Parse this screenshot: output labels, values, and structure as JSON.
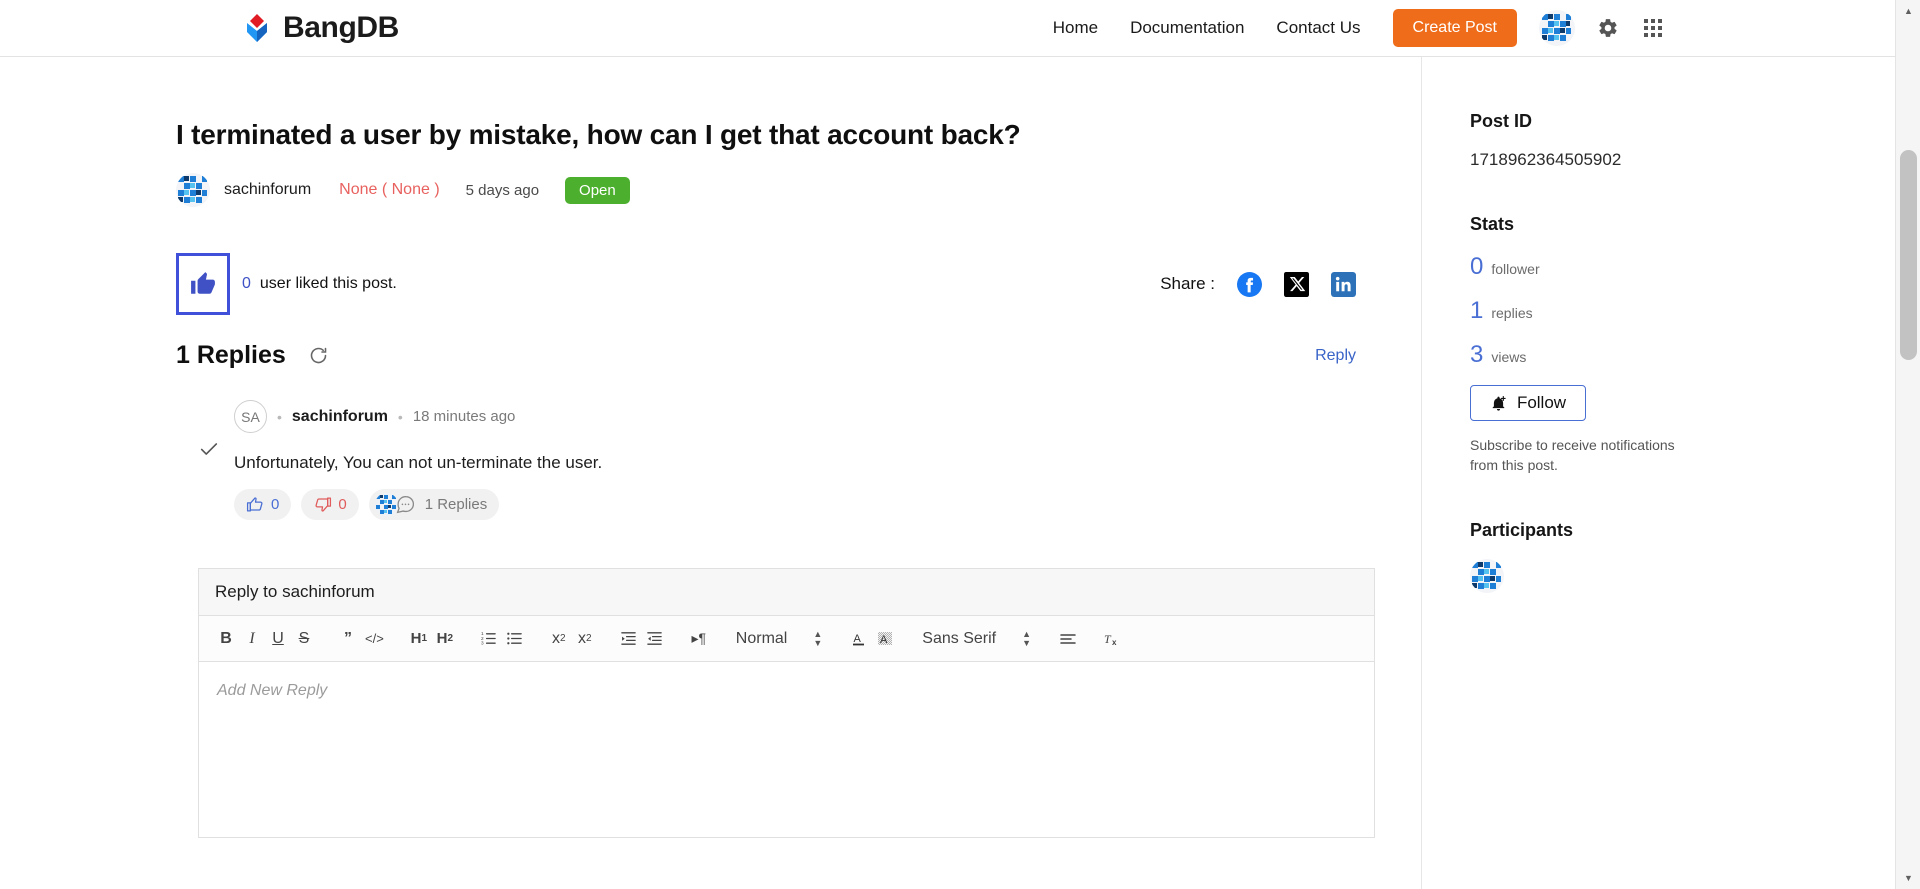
{
  "header": {
    "brand": "BangDB",
    "brand_logo_icon": "bangdb-diamond-logo",
    "nav": [
      {
        "label": "Home"
      },
      {
        "label": "Documentation"
      },
      {
        "label": "Contact Us"
      }
    ],
    "create_post_label": "Create Post",
    "create_post_color": "#ef6c1a",
    "avatar_icon": "user-avatar",
    "gear_icon": "gear-icon",
    "apps_icon": "apps-grid-icon"
  },
  "post": {
    "title": "I terminated a user by mistake, how can I get that account back?",
    "author": "sachinforum",
    "author_avatar_icon": "user-avatar",
    "category": "None ( None )",
    "category_color": "#e8615e",
    "time": "5 days ago",
    "status": "Open",
    "status_color": "#4caf2e"
  },
  "likes": {
    "icon": "thumbs-up-icon",
    "count": "0",
    "text": "user liked this post.",
    "focus_outline_color": "#4050d8"
  },
  "share": {
    "label": "Share :",
    "targets": [
      {
        "name": "facebook-icon",
        "color": "#1877f2"
      },
      {
        "name": "x-twitter-icon",
        "color": "#000000"
      },
      {
        "name": "linkedin-icon",
        "color": "#0a66c2"
      }
    ]
  },
  "replies_section": {
    "title": "1 Replies",
    "refresh_icon": "refresh-icon",
    "reply_link": "Reply"
  },
  "reply": {
    "check_icon": "check-icon",
    "avatar_initials": "SA",
    "author": "sachinforum",
    "time": "18 minutes ago",
    "body": "Unfortunately, You can not un-terminate the user.",
    "like_icon": "thumbs-up-icon",
    "like_count": "0",
    "dislike_icon": "thumbs-down-icon",
    "dislike_count": "0",
    "comment_icon": "comment-bubble-icon",
    "replies_label": "1 Replies"
  },
  "editor": {
    "reply_to_label": "Reply to sachinforum",
    "placeholder": "Add New Reply",
    "toolbar": {
      "bold": "B",
      "italic": "I",
      "underline": "U",
      "strike": "S",
      "blockquote_icon": "blockquote-icon",
      "code_icon": "code-icon",
      "h1": "H1",
      "h2": "H2",
      "ordered_list_icon": "ordered-list-icon",
      "bullet_list_icon": "bullet-list-icon",
      "subscript": "x2",
      "superscript": "x2",
      "outdent_icon": "outdent-icon",
      "indent_icon": "indent-icon",
      "direction_icon": "text-direction-icon",
      "block_format": "Normal",
      "font_color_icon": "font-color-icon",
      "highlight_icon": "highlight-color-icon",
      "font_family": "Sans Serif",
      "align_icon": "align-icon",
      "clear_format_icon": "clear-formatting-icon"
    }
  },
  "sidebar": {
    "post_id_heading": "Post ID",
    "post_id": "1718962364505902",
    "stats_heading": "Stats",
    "stats": [
      {
        "num": "0",
        "label": "follower"
      },
      {
        "num": "1",
        "label": "replies"
      },
      {
        "num": "3",
        "label": "views"
      }
    ],
    "follow_label": "Follow",
    "follow_icon": "bell-plus-icon",
    "follow_note": "Subscribe to receive notifications from this post.",
    "participants_heading": "Participants",
    "participant_avatar_icon": "user-avatar"
  },
  "scrollbar": {
    "up_arrow_icon": "chevron-up-icon",
    "down_arrow_icon": "chevron-down-icon"
  }
}
